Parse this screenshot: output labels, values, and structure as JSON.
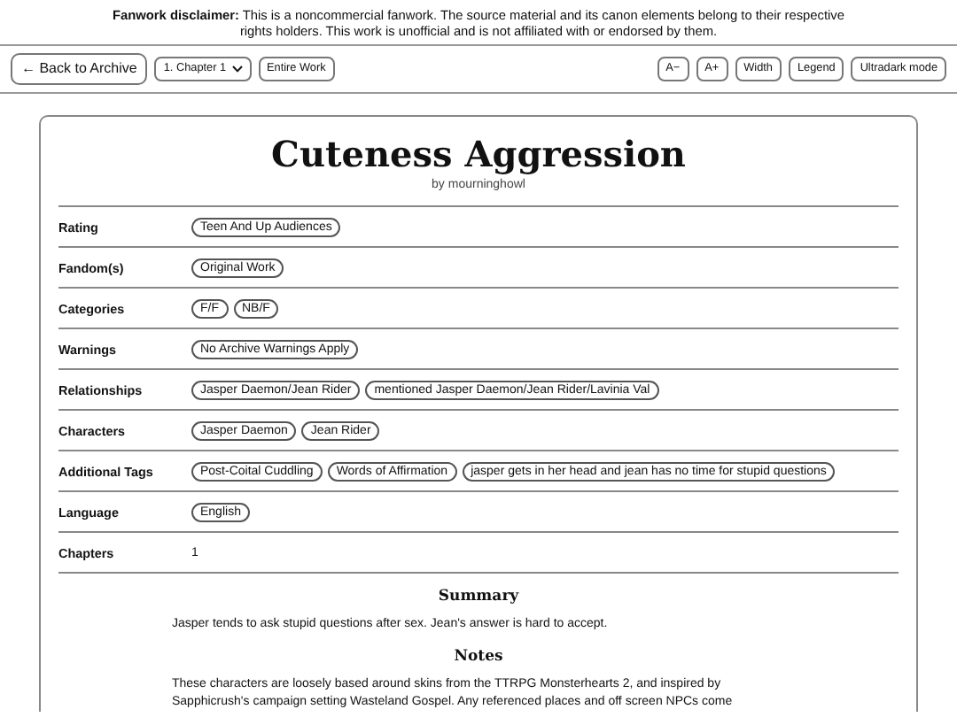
{
  "disclaimer": {
    "label": "Fanwork disclaimer:",
    "text": "This is a noncommercial fanwork. The source material and its canon elements belong to their respective rights holders. This work is unofficial and is not affiliated with or endorsed by them."
  },
  "toolbar": {
    "back": "← Back to Archive",
    "chapter_select": "1. Chapter 1",
    "entire_work": "Entire Work",
    "right_buttons": [
      "A−",
      "A+",
      "Width",
      "Legend",
      "Ultradark mode"
    ]
  },
  "work": {
    "title": "Cuteness Aggression",
    "author": "by mourninghowl",
    "meta": [
      {
        "label": "Rating",
        "kind": "tags",
        "values": [
          "Teen And Up Audiences"
        ]
      },
      {
        "label": "Fandom(s)",
        "kind": "tags",
        "values": [
          "Original Work"
        ]
      },
      {
        "label": "Categories",
        "kind": "tags",
        "values": [
          "F/F",
          "NB/F"
        ]
      },
      {
        "label": "Warnings",
        "kind": "tags",
        "values": [
          "No Archive Warnings Apply"
        ]
      },
      {
        "label": "Relationships",
        "kind": "tags",
        "values": [
          "Jasper Daemon/Jean Rider",
          "mentioned Jasper Daemon/Jean Rider/Lavinia Val"
        ]
      },
      {
        "label": "Characters",
        "kind": "tags",
        "values": [
          "Jasper Daemon",
          "Jean Rider"
        ]
      },
      {
        "label": "Additional Tags",
        "kind": "tags",
        "values": [
          "Post-Coital Cuddling",
          "Words of Affirmation",
          "jasper gets in her head and jean has no time for stupid questions"
        ]
      },
      {
        "label": "Language",
        "kind": "tags",
        "values": [
          "English"
        ]
      },
      {
        "label": "Chapters",
        "kind": "text",
        "values": [
          "1"
        ]
      }
    ],
    "sections": [
      {
        "heading": "Summary",
        "text": "Jasper tends to ask stupid questions after sex. Jean's answer is hard to accept."
      },
      {
        "heading": "Notes",
        "text": "These characters are loosely based around skins from the TTRPG Monsterhearts 2, and inspired by Sapphicrush's campaign setting Wasteland Gospel. Any referenced places and off screen NPCs come"
      }
    ]
  }
}
